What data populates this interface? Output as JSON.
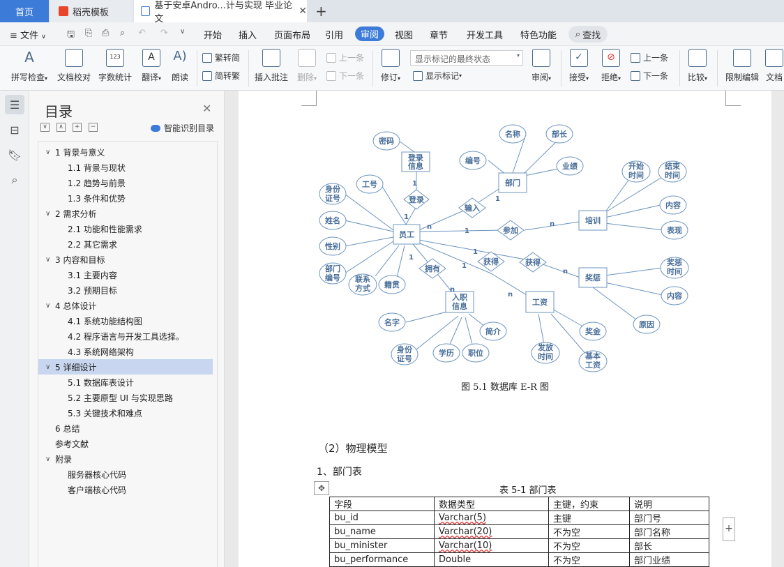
{
  "tabs": {
    "home": "首页",
    "template": "稻壳模板",
    "doc": "基于安卓Andro...计与实现 毕业论文"
  },
  "menu": {
    "file": "文件",
    "items": [
      "开始",
      "插入",
      "页面布局",
      "引用",
      "审阅",
      "视图",
      "章节",
      "开发工具",
      "特色功能"
    ],
    "search": "查找"
  },
  "ribbon": {
    "spell": "拼写检查",
    "proofread": "文档校对",
    "wordcount": "字数统计",
    "translate": "翻译",
    "read": "朗读",
    "trad": "繁转简",
    "simp": "简转繁",
    "insert_comment": "插入批注",
    "delete": "删除",
    "prev": "上一条",
    "next": "下一条",
    "track": "修订",
    "markup_select": "显示标记的最终状态",
    "show_markup": "显示标记",
    "review": "审阅",
    "accept": "接受",
    "reject": "拒绝",
    "prev2": "上一条",
    "next2": "下一条",
    "compare": "比较",
    "restrict": "限制编辑",
    "doc_more": "文档"
  },
  "toc": {
    "title": "目录",
    "ai": "智能识别目录",
    "items": [
      {
        "text": "1  背景与意义",
        "level": 1,
        "chev": true
      },
      {
        "text": "1.1  背景与现状",
        "level": 2
      },
      {
        "text": "1.2  趋势与前景",
        "level": 2
      },
      {
        "text": "1.3  条件和优势",
        "level": 2
      },
      {
        "text": "2  需求分析",
        "level": 1,
        "chev": true
      },
      {
        "text": "2.1  功能和性能需求",
        "level": 2
      },
      {
        "text": "2.2  其它需求",
        "level": 2
      },
      {
        "text": "3  内容和目标",
        "level": 1,
        "chev": true
      },
      {
        "text": "3.1   主要内容",
        "level": 2
      },
      {
        "text": "3.2   预期目标",
        "level": 2
      },
      {
        "text": "4  总体设计",
        "level": 1,
        "chev": true
      },
      {
        "text": "4.1 系统功能结构图",
        "level": 2
      },
      {
        "text": "4.2  程序语言与开发工具选择。",
        "level": 2
      },
      {
        "text": "4.3  系统网络架构",
        "level": 2
      },
      {
        "text": "5  详细设计",
        "level": 1,
        "chev": true,
        "selected": true
      },
      {
        "text": "5.1  数据库表设计",
        "level": 2
      },
      {
        "text": "5.2  主要原型 UI 与实现思路",
        "level": 2
      },
      {
        "text": "5.3  关键技术和难点",
        "level": 2
      },
      {
        "text": "6  总结",
        "level": 1
      },
      {
        "text": "参考文献",
        "level": 1
      },
      {
        "text": "附录",
        "level": 1,
        "chev": true
      },
      {
        "text": "服务器核心代码",
        "level": 2
      },
      {
        "text": "客户端核心代码",
        "level": 2
      }
    ]
  },
  "diagram": {
    "entities": [
      "登录信息",
      "部门",
      "员工",
      "培训",
      "奖惩",
      "入职信息",
      "工资"
    ],
    "relations": [
      "登录",
      "输入",
      "参加",
      "获得",
      "拥有",
      "获得"
    ],
    "attributes": [
      "密码",
      "名称",
      "部长",
      "编号",
      "业绩",
      "工号",
      "身份证号",
      "开始时间",
      "结束时间",
      "姓名",
      "内容",
      "表现",
      "性别",
      "部门编号",
      "联系方式",
      "籍贯",
      "奖惩时间",
      "内容",
      "名字",
      "简介",
      "原因",
      "奖金",
      "身份证号",
      "学历",
      "职位",
      "发放时间",
      "基本工资"
    ],
    "cardinalities": [
      "1",
      "1",
      "n",
      "1",
      "1",
      "n",
      "1",
      "n",
      "1",
      "1",
      "n",
      "n"
    ],
    "caption": "图 5.1   数据库 E-R 图"
  },
  "doc": {
    "section": "（2）物理模型",
    "subsection": "1、部门表",
    "table_caption": "表 5-1  部门表",
    "table": {
      "headers": [
        "字段",
        "数据类型",
        "主键，约束",
        "说明"
      ],
      "rows": [
        [
          "bu_id",
          "Varchar(5)",
          "主键",
          "部门号"
        ],
        [
          "bu_name",
          "Varchar(20)",
          "不为空",
          "部门名称"
        ],
        [
          "bu_minister",
          "Varchar(10)",
          "不为空",
          "部长"
        ],
        [
          "bu_performance",
          "Double",
          "不为空",
          "部门业绩"
        ]
      ]
    }
  }
}
